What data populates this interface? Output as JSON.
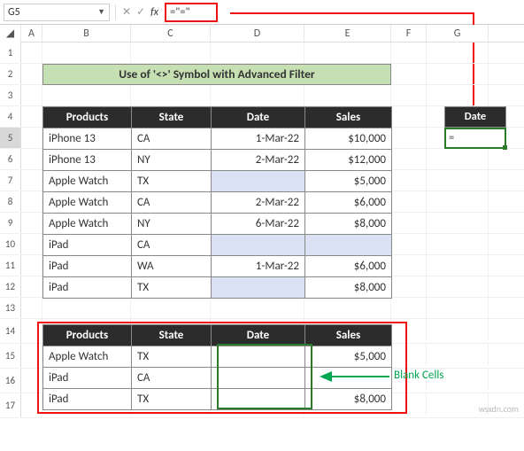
{
  "namebox": "G5",
  "formula": "=\"=\"",
  "fx_label": "fx",
  "col_heads": [
    "A",
    "B",
    "C",
    "D",
    "E",
    "F",
    "G"
  ],
  "row_heads": [
    "1",
    "2",
    "3",
    "4",
    "5",
    "6",
    "7",
    "8",
    "9",
    "10",
    "11",
    "12",
    "13",
    "14",
    "15",
    "16",
    "17"
  ],
  "title": "Use of '<>'  Symbol with Advanced Filter",
  "headers": {
    "products": "Products",
    "state": "State",
    "date": "Date",
    "sales": "Sales"
  },
  "table1": [
    {
      "p": "iPhone 13",
      "s": "CA",
      "d": "1-Mar-22",
      "v": "$10,000"
    },
    {
      "p": "iPhone 13",
      "s": "NY",
      "d": "2-Mar-22",
      "v": "$12,000"
    },
    {
      "p": "Apple Watch",
      "s": "TX",
      "d": "",
      "v": "$5,000",
      "blank": true
    },
    {
      "p": "Apple Watch",
      "s": "CA",
      "d": "2-Mar-22",
      "v": "$6,000"
    },
    {
      "p": "Apple Watch",
      "s": "NY",
      "d": "6-Mar-22",
      "v": "$8,000"
    },
    {
      "p": "iPad",
      "s": "CA",
      "d": "",
      "v": "",
      "blank": true
    },
    {
      "p": "iPad",
      "s": "WA",
      "d": "1-Mar-22",
      "v": "$6,000"
    },
    {
      "p": "iPad",
      "s": "TX",
      "d": "",
      "v": "$8,000",
      "blank": true
    }
  ],
  "table2": [
    {
      "p": "Apple Watch",
      "s": "TX",
      "d": "",
      "v": "$5,000"
    },
    {
      "p": "iPad",
      "s": "CA",
      "d": "",
      "v": ""
    },
    {
      "p": "iPad",
      "s": "TX",
      "d": "",
      "v": "$8,000"
    }
  ],
  "criteria": {
    "header": "Date",
    "value": "="
  },
  "annotation": "Blank Cells",
  "watermark": "wsxdn.com"
}
